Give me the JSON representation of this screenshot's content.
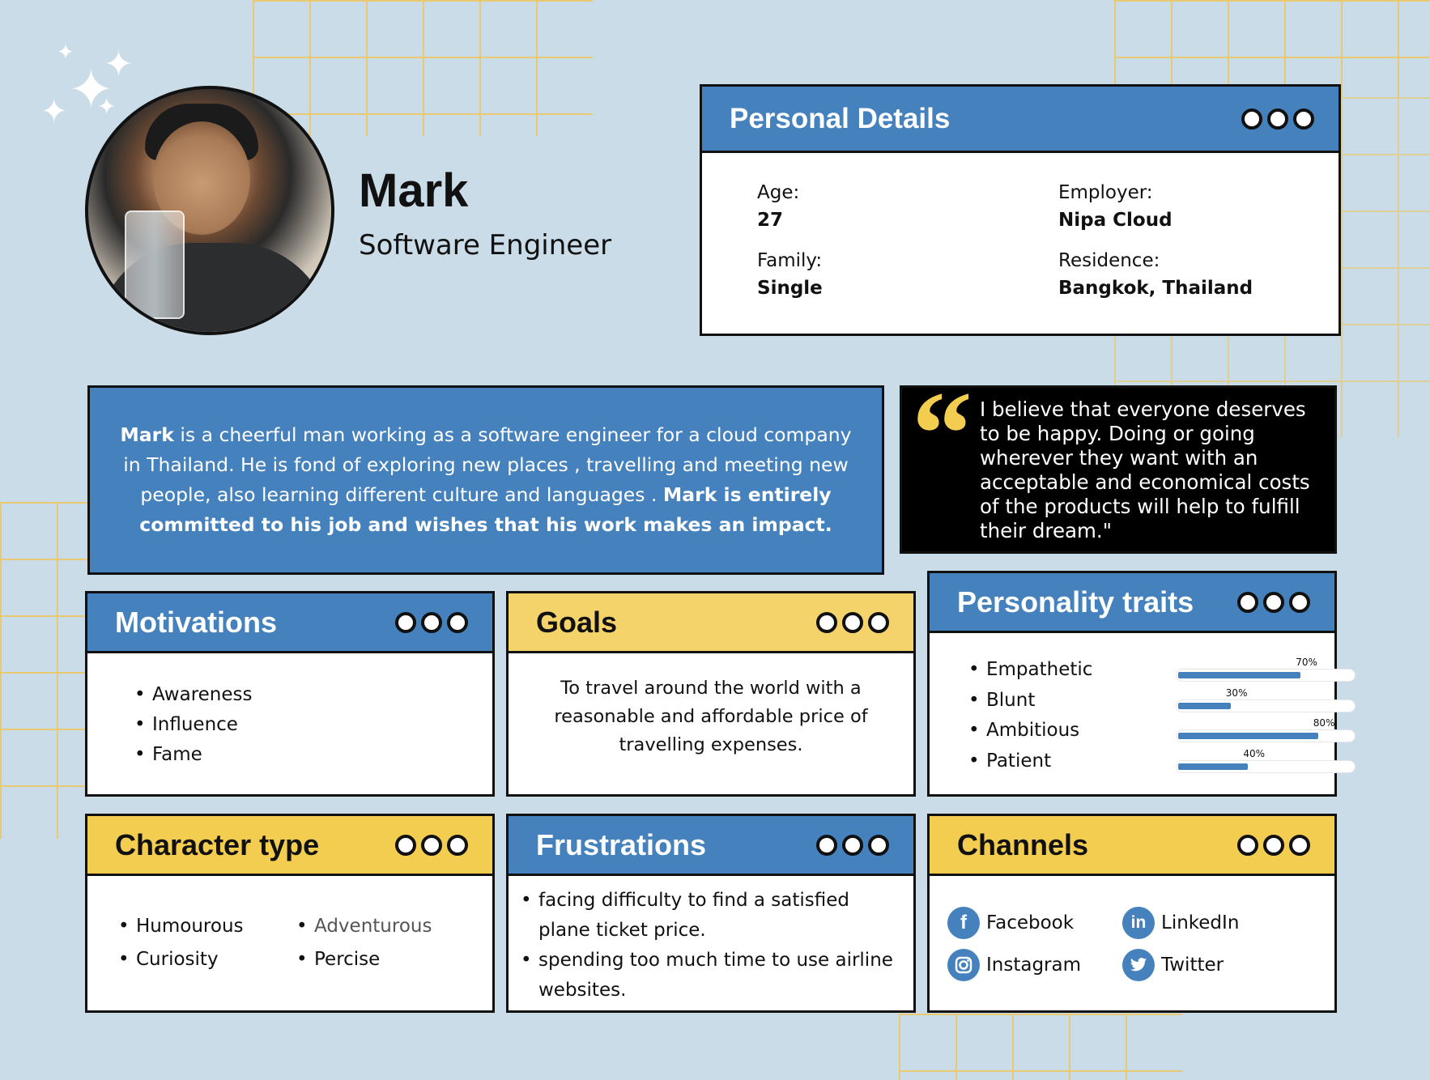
{
  "profile": {
    "name": "Mark",
    "role": "Software Engineer"
  },
  "personal_details": {
    "title": "Personal Details",
    "age_label": "Age:",
    "age": "27",
    "employer_label": "Employer:",
    "employer": "Nipa Cloud",
    "family_label": "Family:",
    "family": "Single",
    "residence_label": "Residence:",
    "residence": "Bangkok, Thailand"
  },
  "bio": {
    "name": "Mark",
    "text1": " is a cheerful man working as a software engineer for a cloud company in Thailand.  He is fond of exploring new places , travelling and meeting new people, also learning different culture and languages . ",
    "bold_text": "Mark is entirely committed to his job and wishes that his work makes an impact."
  },
  "quote": {
    "text": "I believe that everyone deserves to be happy. Doing or going wherever they want  with an acceptable and economical costs of the products will help to fulfill their dream.\""
  },
  "motivations": {
    "title": "Motivations",
    "items": [
      "Awareness",
      "Influence",
      "Fame"
    ]
  },
  "goals": {
    "title": "Goals",
    "text": "To travel around the world with a reasonable and affordable price of travelling expenses."
  },
  "personality": {
    "title": "Personality traits",
    "traits": [
      {
        "name": "Empathetic",
        "value": 70,
        "label": "70%"
      },
      {
        "name": "Blunt",
        "value": 30,
        "label": "30%"
      },
      {
        "name": "Ambitious",
        "value": 80,
        "label": "80%"
      },
      {
        "name": "Patient",
        "value": 40,
        "label": "40%"
      }
    ]
  },
  "character": {
    "title": "Character type",
    "items": [
      "Humourous",
      "Adventurous",
      "Curiosity",
      "Percise"
    ]
  },
  "frustrations": {
    "title": "Frustrations",
    "items": [
      "facing difficulty to find a satisfied plane ticket price.",
      "spending too much time to use  airline websites."
    ]
  },
  "channels": {
    "title": "Channels",
    "items": [
      {
        "name": "Facebook",
        "icon": "facebook-icon"
      },
      {
        "name": "LinkedIn",
        "icon": "linkedin-icon"
      },
      {
        "name": "Instagram",
        "icon": "instagram-icon"
      },
      {
        "name": "Twitter",
        "icon": "twitter-icon"
      }
    ]
  },
  "colors": {
    "blue": "#4581bd",
    "yellow": "#f3cd50",
    "background": "#c9dce7"
  }
}
